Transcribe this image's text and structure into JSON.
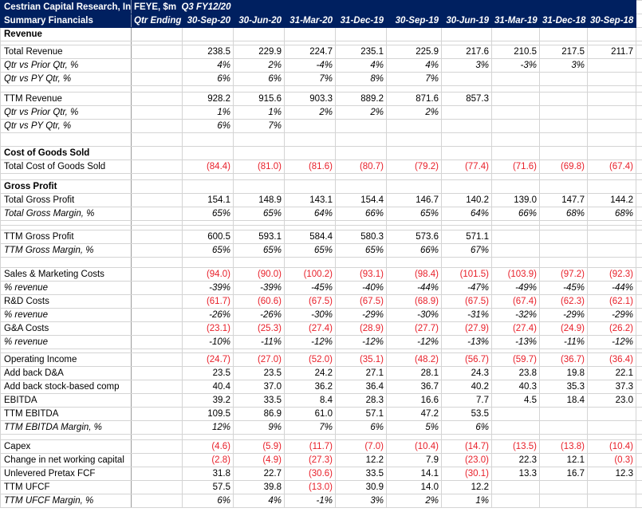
{
  "header": {
    "company": "Cestrian Capital Research, Inc",
    "subtitle": "Summary Financials",
    "ticker_units": "FEYE, $m",
    "fiscal_label": "Q3 FY12/20",
    "qtr_ending_label": "Qtr Ending",
    "periods": [
      "30-Sep-20",
      "30-Jun-20",
      "31-Mar-20",
      "31-Dec-19",
      "30-Sep-19",
      "30-Jun-19",
      "31-Mar-19",
      "31-Dec-18",
      "30-Sep-18"
    ]
  },
  "colors": {
    "header_bg": "#002060",
    "header_text": "#ffffff",
    "negative": "#e8202a",
    "gridline": "#d4d4d4"
  },
  "rows": [
    {
      "id": "revenue-header",
      "label": "Revenue",
      "style": "section",
      "values": []
    },
    {
      "id": "total-revenue",
      "label": "Total Revenue",
      "style": "normal",
      "values": [
        "238.5",
        "229.9",
        "224.7",
        "235.1",
        "225.9",
        "217.6",
        "210.5",
        "217.5",
        "211.7"
      ]
    },
    {
      "id": "rev-qoq",
      "label": "Qtr vs Prior Qtr, %",
      "style": "italic",
      "values": [
        "4%",
        "2%",
        "-4%",
        "4%",
        "4%",
        "3%",
        "-3%",
        "3%",
        ""
      ]
    },
    {
      "id": "rev-yoy",
      "label": "Qtr vs PY Qtr, %",
      "style": "italic",
      "values": [
        "6%",
        "6%",
        "7%",
        "8%",
        "7%",
        "",
        "",
        "",
        ""
      ]
    },
    {
      "id": "ttm-revenue",
      "label": "TTM Revenue",
      "style": "normal",
      "values": [
        "928.2",
        "915.6",
        "903.3",
        "889.2",
        "871.6",
        "857.3",
        "",
        "",
        ""
      ]
    },
    {
      "id": "ttm-rev-qoq",
      "label": "Qtr vs Prior Qtr, %",
      "style": "italic",
      "values": [
        "1%",
        "1%",
        "2%",
        "2%",
        "2%",
        "",
        "",
        "",
        ""
      ]
    },
    {
      "id": "ttm-rev-yoy",
      "label": "Qtr vs PY Qtr, %",
      "style": "italic",
      "values": [
        "6%",
        "7%",
        "",
        "",
        "",
        "",
        "",
        "",
        ""
      ]
    },
    {
      "id": "cogs-header",
      "label": "Cost of Goods Sold",
      "style": "section",
      "values": []
    },
    {
      "id": "total-cogs",
      "label": "Total Cost of Goods Sold",
      "style": "normal",
      "values": [
        "(84.4)",
        "(81.0)",
        "(81.6)",
        "(80.7)",
        "(79.2)",
        "(77.4)",
        "(71.6)",
        "(69.8)",
        "(67.4)"
      ]
    },
    {
      "id": "gp-header",
      "label": "Gross Profit",
      "style": "section",
      "values": []
    },
    {
      "id": "total-gp",
      "label": "Total Gross Profit",
      "style": "normal",
      "values": [
        "154.1",
        "148.9",
        "143.1",
        "154.4",
        "146.7",
        "140.2",
        "139.0",
        "147.7",
        "144.2"
      ]
    },
    {
      "id": "total-gm",
      "label": "Total Gross Margin, %",
      "style": "italic",
      "values": [
        "65%",
        "65%",
        "64%",
        "66%",
        "65%",
        "64%",
        "66%",
        "68%",
        "68%"
      ]
    },
    {
      "id": "ttm-gp",
      "label": "TTM Gross Profit",
      "style": "normal",
      "values": [
        "600.5",
        "593.1",
        "584.4",
        "580.3",
        "573.6",
        "571.1",
        "",
        "",
        ""
      ]
    },
    {
      "id": "ttm-gm",
      "label": "TTM Gross Margin, %",
      "style": "italic",
      "values": [
        "65%",
        "65%",
        "65%",
        "65%",
        "66%",
        "67%",
        "",
        "",
        ""
      ]
    },
    {
      "id": "sm-costs",
      "label": "Sales & Marketing Costs",
      "style": "normal",
      "values": [
        "(94.0)",
        "(90.0)",
        "(100.2)",
        "(93.1)",
        "(98.4)",
        "(101.5)",
        "(103.9)",
        "(97.2)",
        "(92.3)"
      ]
    },
    {
      "id": "sm-pct",
      "label": "% revenue",
      "style": "italic",
      "values": [
        "-39%",
        "-39%",
        "-45%",
        "-40%",
        "-44%",
        "-47%",
        "-49%",
        "-45%",
        "-44%"
      ]
    },
    {
      "id": "rd-costs",
      "label": "R&D Costs",
      "style": "normal",
      "values": [
        "(61.7)",
        "(60.6)",
        "(67.5)",
        "(67.5)",
        "(68.9)",
        "(67.5)",
        "(67.4)",
        "(62.3)",
        "(62.1)"
      ]
    },
    {
      "id": "rd-pct",
      "label": "% revenue",
      "style": "italic",
      "values": [
        "-26%",
        "-26%",
        "-30%",
        "-29%",
        "-30%",
        "-31%",
        "-32%",
        "-29%",
        "-29%"
      ]
    },
    {
      "id": "ga-costs",
      "label": "G&A Costs",
      "style": "normal",
      "values": [
        "(23.1)",
        "(25.3)",
        "(27.4)",
        "(28.9)",
        "(27.7)",
        "(27.9)",
        "(27.4)",
        "(24.9)",
        "(26.2)"
      ]
    },
    {
      "id": "ga-pct",
      "label": "% revenue",
      "style": "italic",
      "values": [
        "-10%",
        "-11%",
        "-12%",
        "-12%",
        "-12%",
        "-13%",
        "-13%",
        "-11%",
        "-12%"
      ]
    },
    {
      "id": "op-income",
      "label": "Operating Income",
      "style": "normal",
      "values": [
        "(24.7)",
        "(27.0)",
        "(52.0)",
        "(35.1)",
        "(48.2)",
        "(56.7)",
        "(59.7)",
        "(36.7)",
        "(36.4)"
      ]
    },
    {
      "id": "add-da",
      "label": "Add back D&A",
      "style": "normal",
      "values": [
        "23.5",
        "23.5",
        "24.2",
        "27.1",
        "28.1",
        "24.3",
        "23.8",
        "19.8",
        "22.1"
      ]
    },
    {
      "id": "add-sbc",
      "label": "Add back stock-based comp",
      "style": "normal",
      "values": [
        "40.4",
        "37.0",
        "36.2",
        "36.4",
        "36.7",
        "40.2",
        "40.3",
        "35.3",
        "37.3"
      ]
    },
    {
      "id": "ebitda",
      "label": "EBITDA",
      "style": "normal",
      "values": [
        "39.2",
        "33.5",
        "8.4",
        "28.3",
        "16.6",
        "7.7",
        "4.5",
        "18.4",
        "23.0"
      ]
    },
    {
      "id": "ttm-ebitda",
      "label": "TTM EBITDA",
      "style": "normal",
      "values": [
        "109.5",
        "86.9",
        "61.0",
        "57.1",
        "47.2",
        "53.5",
        "",
        "",
        ""
      ]
    },
    {
      "id": "ttm-ebitda-margin",
      "label": "TTM EBITDA Margin, %",
      "style": "italic",
      "values": [
        "12%",
        "9%",
        "7%",
        "6%",
        "5%",
        "6%",
        "",
        "",
        ""
      ]
    },
    {
      "id": "capex",
      "label": "Capex",
      "style": "normal",
      "values": [
        "(4.6)",
        "(5.9)",
        "(11.7)",
        "(7.0)",
        "(10.4)",
        "(14.7)",
        "(13.5)",
        "(13.8)",
        "(10.4)"
      ]
    },
    {
      "id": "nwc",
      "label": "Change in net working capital",
      "style": "normal",
      "values": [
        "(2.8)",
        "(4.9)",
        "(27.3)",
        "12.2",
        "7.9",
        "(23.0)",
        "22.3",
        "12.1",
        "(0.3)"
      ]
    },
    {
      "id": "ufcf",
      "label": "Unlevered Pretax FCF",
      "style": "normal",
      "values": [
        "31.8",
        "22.7",
        "(30.6)",
        "33.5",
        "14.1",
        "(30.1)",
        "13.3",
        "16.7",
        "12.3"
      ]
    },
    {
      "id": "ttm-ufcf",
      "label": "TTM UFCF",
      "style": "normal",
      "values": [
        "57.5",
        "39.8",
        "(13.0)",
        "30.9",
        "14.0",
        "12.2",
        "",
        "",
        ""
      ]
    },
    {
      "id": "ttm-ufcf-margin",
      "label": "TTM UFCF Margin, %",
      "style": "italic",
      "values": [
        "6%",
        "4%",
        "-1%",
        "3%",
        "2%",
        "1%",
        "",
        "",
        ""
      ]
    }
  ]
}
